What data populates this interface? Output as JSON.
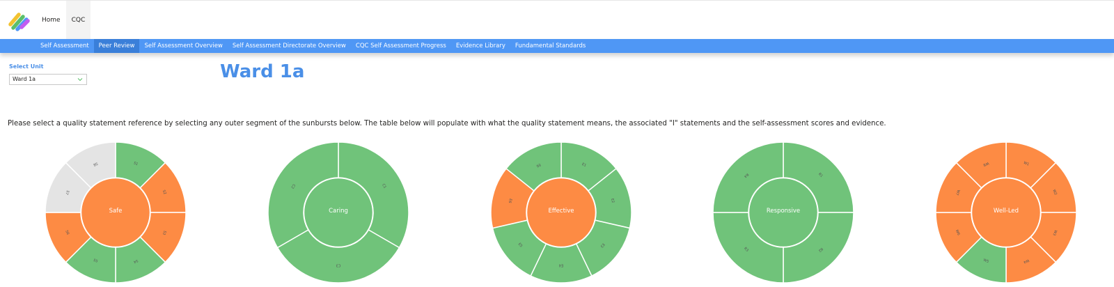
{
  "header": {
    "nav": [
      {
        "label": "Home",
        "active": false
      },
      {
        "label": "CQC",
        "active": true
      }
    ]
  },
  "subnav": {
    "items": [
      {
        "label": "Self Assessment",
        "active": false
      },
      {
        "label": "Peer Review",
        "active": true
      },
      {
        "label": "Self Assessment Overview",
        "active": false
      },
      {
        "label": "Self Assessment Directorate Overview",
        "active": false
      },
      {
        "label": "CQC Self Assessment Progress",
        "active": false
      },
      {
        "label": "Evidence Library",
        "active": false
      },
      {
        "label": "Fundamental Standards",
        "active": false
      }
    ]
  },
  "select_unit": {
    "label": "Select Unit",
    "value": "Ward 1a"
  },
  "unit_title": "Ward 1a",
  "instructions": "Please select a quality statement reference by selecting any outer segment of the sunbursts below. The table below will populate with what the quality statement means, the associated \"I\" statements and the self-assessment scores and evidence.",
  "colors": {
    "green": "#70c37a",
    "orange": "#fd8b44",
    "grey": "#e4e4e4",
    "accent": "#4f97f5"
  },
  "chart_data": [
    {
      "type": "sunburst",
      "center": {
        "label": "Safe",
        "status": "orange"
      },
      "segments": [
        {
          "label": "S1",
          "status": "green"
        },
        {
          "label": "S2",
          "status": "orange"
        },
        {
          "label": "S3",
          "status": "orange"
        },
        {
          "label": "S4",
          "status": "green"
        },
        {
          "label": "S5",
          "status": "green"
        },
        {
          "label": "S6",
          "status": "orange"
        },
        {
          "label": "S7",
          "status": "grey"
        },
        {
          "label": "S8",
          "status": "grey"
        }
      ]
    },
    {
      "type": "sunburst",
      "center": {
        "label": "Caring",
        "status": "green"
      },
      "segments": [
        {
          "label": "C1",
          "status": "green"
        },
        {
          "label": "C3",
          "status": "green"
        },
        {
          "label": "C2",
          "status": "green"
        }
      ]
    },
    {
      "type": "sunburst",
      "center": {
        "label": "Effective",
        "status": "orange"
      },
      "segments": [
        {
          "label": "E1",
          "status": "green"
        },
        {
          "label": "E2",
          "status": "green"
        },
        {
          "label": "E3",
          "status": "green"
        },
        {
          "label": "E4",
          "status": "green"
        },
        {
          "label": "E5",
          "status": "green"
        },
        {
          "label": "E6",
          "status": "orange"
        },
        {
          "label": "E6",
          "status": "green"
        }
      ]
    },
    {
      "type": "sunburst",
      "center": {
        "label": "Responsive",
        "status": "green"
      },
      "segments": [
        {
          "label": "R1",
          "status": "green"
        },
        {
          "label": "R2",
          "status": "green"
        },
        {
          "label": "R3",
          "status": "green"
        },
        {
          "label": "R4",
          "status": "green"
        }
      ]
    },
    {
      "type": "sunburst",
      "center": {
        "label": "Well-Led",
        "status": "orange"
      },
      "segments": [
        {
          "label": "W1",
          "status": "orange"
        },
        {
          "label": "W2",
          "status": "orange"
        },
        {
          "label": "W3",
          "status": "orange"
        },
        {
          "label": "W4",
          "status": "orange"
        },
        {
          "label": "W5",
          "status": "green"
        },
        {
          "label": "W6",
          "status": "orange"
        },
        {
          "label": "W7",
          "status": "orange"
        },
        {
          "label": "W8",
          "status": "orange"
        }
      ]
    }
  ]
}
